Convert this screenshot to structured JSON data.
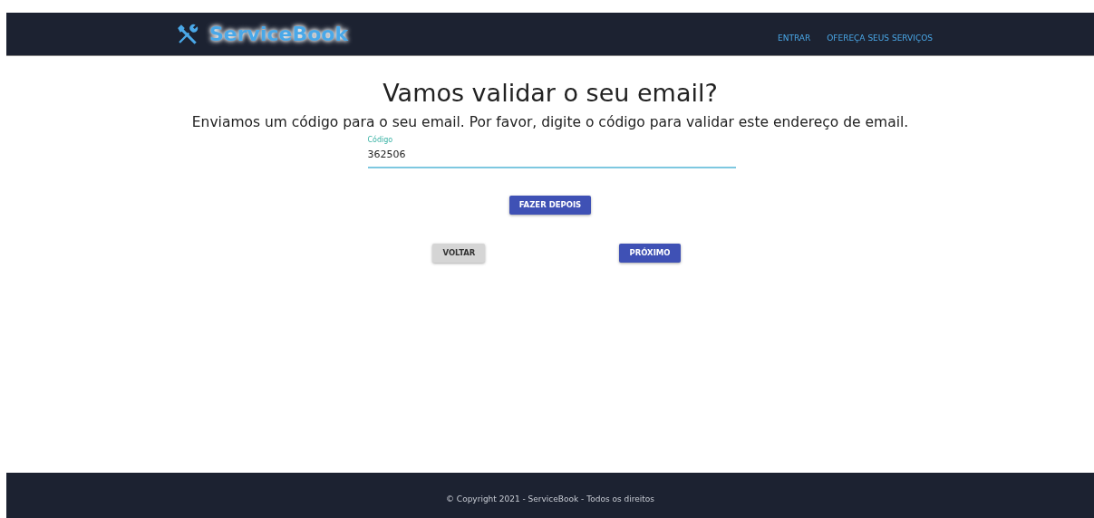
{
  "header": {
    "logo": "ServiceBook",
    "links": [
      "ENTRAR",
      "OFEREÇA SEUS SERVIÇOS"
    ]
  },
  "title": "Vamos validar o seu email?",
  "subtitle": "Enviamos um código para o seu email. Por favor, digite o código para validar este endereço de email.",
  "field": {
    "label": "Código",
    "value": "362506",
    "focused": true
  },
  "buttons": [
    {
      "label": "FAZER DEPOIS",
      "kind": "primary"
    },
    {
      "label": "VOLTAR",
      "kind": "secondary"
    },
    {
      "label": "PRÓXIMO",
      "kind": "primary"
    }
  ],
  "footer": "© Copyright 2021 - ServiceBook - Todos os direitos"
}
